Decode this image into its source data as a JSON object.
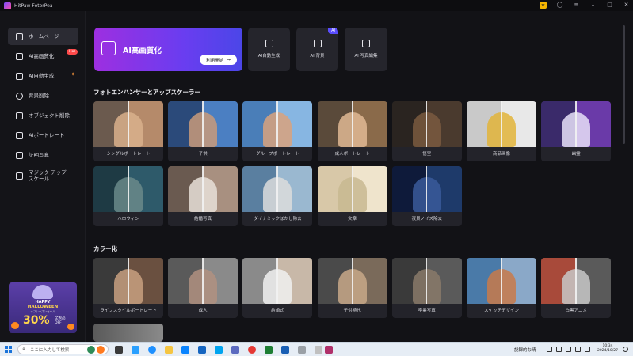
{
  "app": {
    "title": "HitPaw FotorPea"
  },
  "sidebar": {
    "items": [
      {
        "label": "ホームページ",
        "active": true
      },
      {
        "label": "AI高画質化",
        "badge": "Hot"
      },
      {
        "label": "AI自動生成",
        "sparkle": "✦"
      },
      {
        "label": "背景削除"
      },
      {
        "label": "オブジェクト削除"
      },
      {
        "label": "AIポートレート"
      },
      {
        "label": "証明写真"
      },
      {
        "label": "マジック アップスケール"
      }
    ],
    "promo": {
      "line1": "HAPPY",
      "line2": "HALLOWEEN",
      "line3": "— オフシーズンセール —",
      "discount": "30%",
      "suffix1": "全製品",
      "suffix2": "OFF"
    }
  },
  "hero": {
    "title": "AI高画質化",
    "button": "利用開始",
    "arrow": "→"
  },
  "tools": [
    {
      "label": "AI自動生成"
    },
    {
      "label": "AI 背景",
      "badge": "AI"
    },
    {
      "label": "AI 写真編集"
    }
  ],
  "sections": {
    "enhancer": {
      "title": "フォトエンハンサーとアップスケーラー",
      "cards": [
        {
          "label": "シングルポートレート",
          "left": "#6b5a4e",
          "right": "#b58a6a",
          "subject": "#d9b08c"
        },
        {
          "label": "子供",
          "left": "#2b4a7a",
          "right": "#4b7fc2",
          "subject": "#c99a7a"
        },
        {
          "label": "グループポートレート",
          "left": "#4a7eb8",
          "right": "#87b6e2",
          "subject": "#d9a27c"
        },
        {
          "label": "成人ポートレート",
          "left": "#5a4a3a",
          "right": "#8a6a4a",
          "subject": "#e0b894"
        },
        {
          "label": "悟空",
          "left": "#2a2420",
          "right": "#4a3a2e",
          "subject": "#7a5a40"
        },
        {
          "label": "商品画像",
          "left": "#c9c9c9",
          "right": "#e8e8e8",
          "subject": "#e2b43a"
        },
        {
          "label": "幽霊",
          "left": "#3a2a6a",
          "right": "#6a3aa8",
          "subject": "#e8e0f8"
        },
        {
          "label": "ハロウィン",
          "left": "#1e3a44",
          "right": "#2e5a6a",
          "subject": "#6a8a8a"
        },
        {
          "label": "結婚写真",
          "left": "#6a5a50",
          "right": "#a89080",
          "subject": "#e8e0d8"
        },
        {
          "label": "ダイナミックぼかし除去",
          "left": "#5a7fa0",
          "right": "#9ab8d0",
          "subject": "#dcdcdc"
        },
        {
          "label": "文章",
          "left": "#d8c8a8",
          "right": "#efe4cc",
          "subject": "#c8b890"
        },
        {
          "label": "夜景ノイズ除去",
          "left": "#0e1a3a",
          "right": "#1e3a6a",
          "subject": "#3a5a9a"
        }
      ]
    },
    "colorize": {
      "title": "カラー化",
      "cards": [
        {
          "label": "ライフスタイルポートレート",
          "left": "#3a3a3a",
          "right": "#6a5040",
          "subject": "#c8a080"
        },
        {
          "label": "成人",
          "left": "#5a5a5a",
          "right": "#8a8a8a",
          "subject": "#b09080"
        },
        {
          "label": "結婚式",
          "left": "#8a8a8a",
          "right": "#c8b8a8",
          "subject": "#f0f0f0"
        },
        {
          "label": "子供時代",
          "left": "#4a4a4a",
          "right": "#7a6a5a",
          "subject": "#c8a888"
        },
        {
          "label": "卒業写真",
          "left": "#3a3a3a",
          "right": "#5a5a5a",
          "subject": "#8a7a6a"
        },
        {
          "label": "スケッチデザイン",
          "left": "#4a7aa8",
          "right": "#8aa8c8",
          "subject": "#c87a4a"
        },
        {
          "label": "白黒アニメ",
          "left": "#a84a3a",
          "right": "#5a5a5a",
          "subject": "#c8c8c8"
        }
      ]
    }
  },
  "taskbar": {
    "search_placeholder": "ここに入力して検索",
    "tray_text": "記録的な晴",
    "time": "10:34",
    "date": "2024/10/27"
  }
}
